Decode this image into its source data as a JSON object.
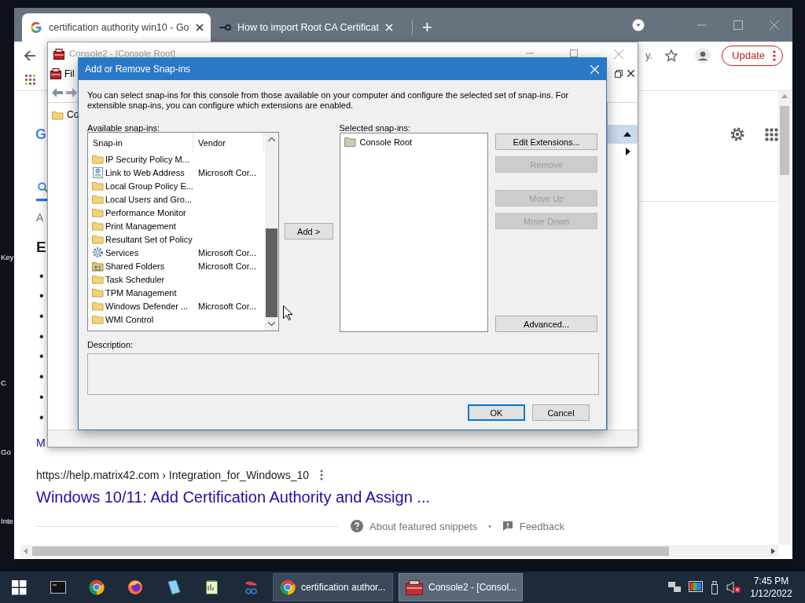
{
  "desktop_labels": [
    "Key",
    "C",
    "Go",
    "Inte"
  ],
  "browser": {
    "tabs": [
      {
        "title": "certification authority win10 - Go",
        "selected": true,
        "kind": "google"
      },
      {
        "title": "How to import Root CA Certificat",
        "selected": false,
        "kind": "link"
      }
    ],
    "new_tab": "+",
    "omnibox_text": "y.",
    "update_button": "Update",
    "page": {
      "logo": "G",
      "about_fragment": "A",
      "heading_fragment": "E",
      "bullets": [
        "•",
        "•",
        "•",
        "•",
        "•",
        "•",
        "•",
        "•"
      ],
      "more_fragment": "M",
      "result_url": "https://help.matrix42.com › Integration_for_Windows_10",
      "result_title": "Windows 10/11: Add Certification Authority and Assign ...",
      "about_snippets": "About featured snippets",
      "separator": "•",
      "feedback": "Feedback"
    }
  },
  "console": {
    "title": "Console2 - [Console Root]",
    "active": false,
    "menu_fragment": "Fil",
    "tree_fragment": "Co"
  },
  "dialog": {
    "title": "Add or Remove Snap-ins",
    "intro": "You can select snap-ins for this console from those available on your computer and configure the selected set of snap-ins. For extensible snap-ins, you can configure which extensions are enabled.",
    "available_label": "Available snap-ins:",
    "columns": [
      "Snap-in",
      "Vendor"
    ],
    "snapins": [
      {
        "name": "IP Security Policy M...",
        "kind": "folder"
      },
      {
        "name": "Link to Web Address",
        "vendor": "Microsoft Cor...",
        "kind": "link"
      },
      {
        "name": "Local Group Policy E...",
        "kind": "folder"
      },
      {
        "name": "Local Users and Gro...",
        "kind": "folder"
      },
      {
        "name": "Performance Monitor",
        "kind": "folder"
      },
      {
        "name": "Print Management",
        "kind": "folder"
      },
      {
        "name": "Resultant Set of Policy",
        "kind": "folder"
      },
      {
        "name": "Services",
        "vendor": "Microsoft Cor...",
        "kind": "gear"
      },
      {
        "name": "Shared Folders",
        "vendor": "Microsoft Cor...",
        "kind": "share"
      },
      {
        "name": "Task Scheduler",
        "kind": "folder"
      },
      {
        "name": "TPM Management",
        "kind": "folder"
      },
      {
        "name": "Windows Defender ...",
        "vendor": "Microsoft Cor...",
        "kind": "folder"
      },
      {
        "name": "WMI Control",
        "kind": "folder"
      }
    ],
    "add_button": "Add >",
    "selected_label": "Selected snap-ins:",
    "selected_snapins": [
      "Console Root"
    ],
    "button_groups": [
      [
        {
          "label": "Edit Extensions...",
          "disabled": false
        },
        {
          "label": "Remove",
          "disabled": true
        }
      ],
      [
        {
          "label": "Move Up",
          "disabled": true
        },
        {
          "label": "Move Down",
          "disabled": true
        }
      ],
      [
        {
          "label": "Advanced...",
          "disabled": false
        }
      ]
    ],
    "description_label": "Description:",
    "footer_buttons": [
      {
        "label": "OK",
        "default": true
      },
      {
        "label": "Cancel",
        "default": false
      }
    ]
  },
  "taskbar": {
    "tasks": [
      {
        "label": "certification author...",
        "selected": false,
        "kind": "chrome"
      },
      {
        "label": "Console2 - [Consol...",
        "selected": true,
        "kind": "console"
      }
    ],
    "time": "7:45 PM",
    "date": "1/12/2022"
  }
}
